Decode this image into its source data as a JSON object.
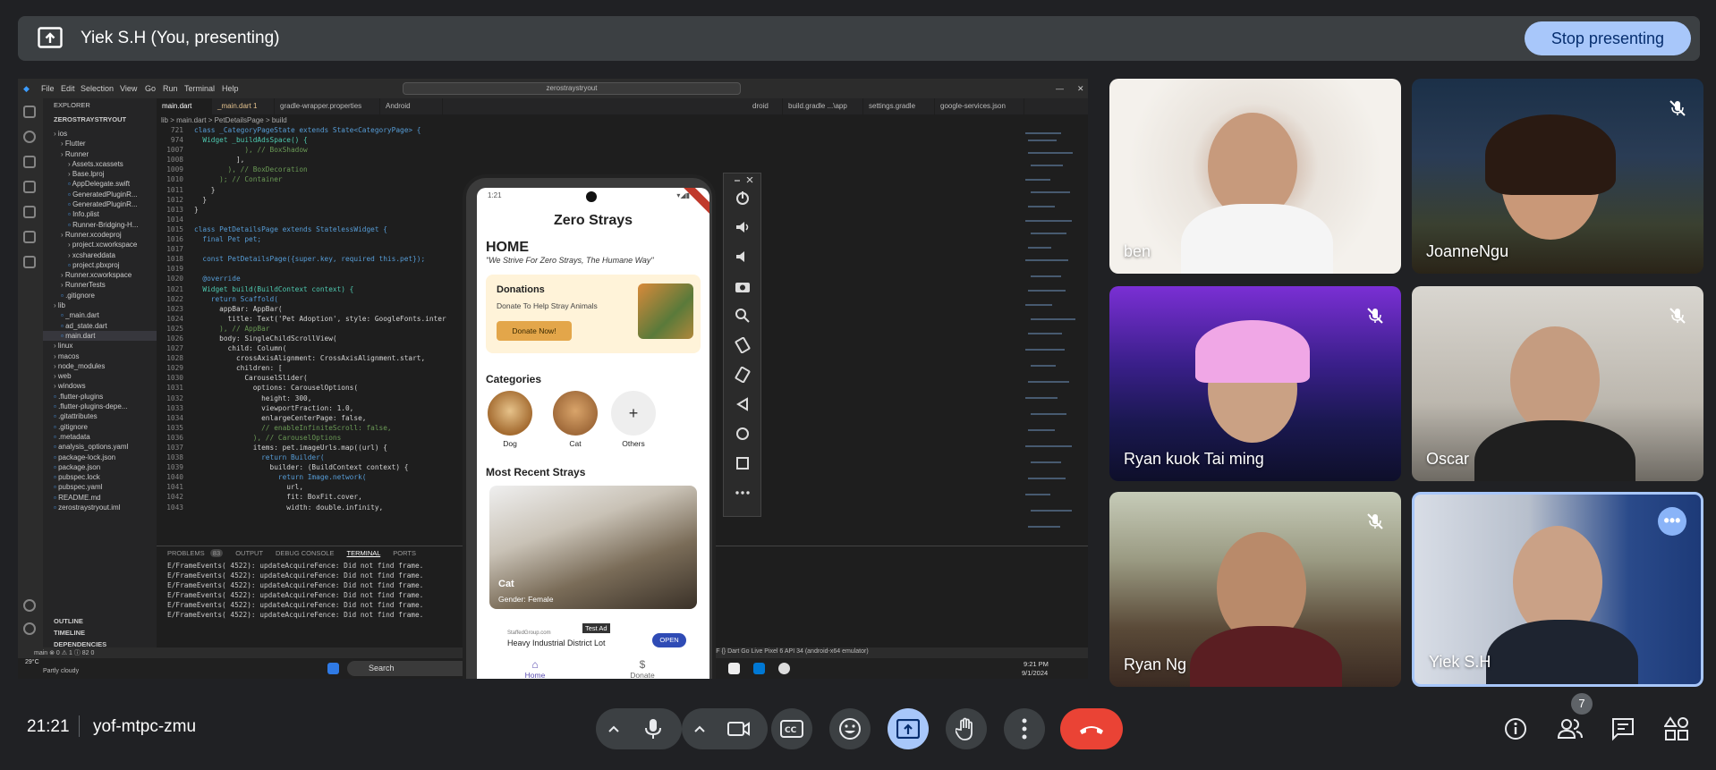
{
  "banner": {
    "title": "Yiek S.H (You, presenting)",
    "stop_label": "Stop presenting"
  },
  "vscode": {
    "menu": [
      "File",
      "Edit",
      "Selection",
      "View",
      "Go",
      "Run",
      "Terminal",
      "Help"
    ],
    "search": "zerostraystryout",
    "explorer_title": "EXPLORER",
    "project": "ZEROSTRAYSTRYOUT",
    "tree": [
      {
        "label": "ios",
        "indent": 0,
        "type": "folder"
      },
      {
        "label": "Flutter",
        "indent": 1,
        "type": "folder"
      },
      {
        "label": "Runner",
        "indent": 1,
        "type": "folder"
      },
      {
        "label": "Assets.xcassets",
        "indent": 2,
        "type": "folder"
      },
      {
        "label": "Base.lproj",
        "indent": 2,
        "type": "folder"
      },
      {
        "label": "AppDelegate.swift",
        "indent": 2,
        "type": "file"
      },
      {
        "label": "GeneratedPluginR...",
        "indent": 2,
        "type": "file"
      },
      {
        "label": "GeneratedPluginR...",
        "indent": 2,
        "type": "file"
      },
      {
        "label": "Info.plist",
        "indent": 2,
        "type": "file"
      },
      {
        "label": "Runner-Bridging-H...",
        "indent": 2,
        "type": "file"
      },
      {
        "label": "Runner.xcodeproj",
        "indent": 1,
        "type": "folder"
      },
      {
        "label": "project.xcworkspace",
        "indent": 2,
        "type": "folder"
      },
      {
        "label": "xcshareddata",
        "indent": 2,
        "type": "folder"
      },
      {
        "label": "project.pbxproj",
        "indent": 2,
        "type": "file"
      },
      {
        "label": "Runner.xcworkspace",
        "indent": 1,
        "type": "folder"
      },
      {
        "label": "RunnerTests",
        "indent": 1,
        "type": "folder"
      },
      {
        "label": ".gitignore",
        "indent": 1,
        "type": "file"
      },
      {
        "label": "lib",
        "indent": 0,
        "type": "folder"
      },
      {
        "label": "_main.dart",
        "indent": 1,
        "type": "file"
      },
      {
        "label": "ad_state.dart",
        "indent": 1,
        "type": "file"
      },
      {
        "label": "main.dart",
        "indent": 1,
        "type": "file",
        "selected": true
      },
      {
        "label": "linux",
        "indent": 0,
        "type": "folder"
      },
      {
        "label": "macos",
        "indent": 0,
        "type": "folder"
      },
      {
        "label": "node_modules",
        "indent": 0,
        "type": "folder"
      },
      {
        "label": "web",
        "indent": 0,
        "type": "folder"
      },
      {
        "label": "windows",
        "indent": 0,
        "type": "folder"
      },
      {
        "label": ".flutter-plugins",
        "indent": 0,
        "type": "file"
      },
      {
        "label": ".flutter-plugins-depe...",
        "indent": 0,
        "type": "file"
      },
      {
        "label": ".gitattributes",
        "indent": 0,
        "type": "file"
      },
      {
        "label": ".gitignore",
        "indent": 0,
        "type": "file"
      },
      {
        "label": ".metadata",
        "indent": 0,
        "type": "file"
      },
      {
        "label": "analysis_options.yaml",
        "indent": 0,
        "type": "file"
      },
      {
        "label": "package-lock.json",
        "indent": 0,
        "type": "file"
      },
      {
        "label": "package.json",
        "indent": 0,
        "type": "file"
      },
      {
        "label": "pubspec.lock",
        "indent": 0,
        "type": "file"
      },
      {
        "label": "pubspec.yaml",
        "indent": 0,
        "type": "file"
      },
      {
        "label": "README.md",
        "indent": 0,
        "type": "file"
      },
      {
        "label": "zerostraystryout.iml",
        "indent": 0,
        "type": "file"
      }
    ],
    "outline": [
      "OUTLINE",
      "TIMELINE",
      "DEPENDENCIES"
    ],
    "tabs": [
      "main.dart",
      "_main.dart 1",
      "gradle-wrapper.properties",
      "Android",
      "droid",
      "build.gradle ...\\app",
      "settings.gradle",
      "google-services.json"
    ],
    "breadcrumb": "lib > main.dart > PetDetailsPage > build",
    "code": [
      {
        "n": "721",
        "t": "class _CategoryPageState extends State<CategoryPage> {"
      },
      {
        "n": "974",
        "t": "  Widget _buildAdsSpace() {"
      },
      {
        "n": "1007",
        "t": "            ), // BoxShadow"
      },
      {
        "n": "1008",
        "t": "          ],"
      },
      {
        "n": "1009",
        "t": "        ), // BoxDecoration"
      },
      {
        "n": "1010",
        "t": "      ); // Container"
      },
      {
        "n": "1011",
        "t": "    }"
      },
      {
        "n": "1012",
        "t": "  }"
      },
      {
        "n": "1013",
        "t": "}"
      },
      {
        "n": "1014",
        "t": ""
      },
      {
        "n": "1015",
        "t": "class PetDetailsPage extends StatelessWidget {"
      },
      {
        "n": "1016",
        "t": "  final Pet pet;"
      },
      {
        "n": "1017",
        "t": ""
      },
      {
        "n": "1018",
        "t": "  const PetDetailsPage({super.key, required this.pet});"
      },
      {
        "n": "1019",
        "t": ""
      },
      {
        "n": "1020",
        "t": "  @override"
      },
      {
        "n": "1021",
        "t": "  Widget build(BuildContext context) {"
      },
      {
        "n": "1022",
        "t": "    return Scaffold("
      },
      {
        "n": "1023",
        "t": "      appBar: AppBar("
      },
      {
        "n": "1024",
        "t": "        title: Text('Pet Adoption', style: GoogleFonts.inter"
      },
      {
        "n": "1025",
        "t": "      ), // AppBar"
      },
      {
        "n": "1026",
        "t": "      body: SingleChildScrollView("
      },
      {
        "n": "1027",
        "t": "        child: Column("
      },
      {
        "n": "1028",
        "t": "          crossAxisAlignment: CrossAxisAlignment.start,"
      },
      {
        "n": "1029",
        "t": "          children: ["
      },
      {
        "n": "1030",
        "t": "            CarouselSlider("
      },
      {
        "n": "1031",
        "t": "              options: CarouselOptions("
      },
      {
        "n": "1032",
        "t": "                height: 300,"
      },
      {
        "n": "1033",
        "t": "                viewportFraction: 1.0,"
      },
      {
        "n": "1034",
        "t": "                enlargeCenterPage: false,"
      },
      {
        "n": "1035",
        "t": "                // enableInfiniteScroll: false,"
      },
      {
        "n": "1036",
        "t": "              ), // CarouselOptions"
      },
      {
        "n": "1037",
        "t": "              items: pet.imageUrls.map((url) {"
      },
      {
        "n": "1038",
        "t": "                return Builder("
      },
      {
        "n": "1039",
        "t": "                  builder: (BuildContext context) {"
      },
      {
        "n": "1040",
        "t": "                    return Image.network("
      },
      {
        "n": "1041",
        "t": "                      url,"
      },
      {
        "n": "1042",
        "t": "                      fit: BoxFit.cover,"
      },
      {
        "n": "1043",
        "t": "                      width: double.infinity,"
      }
    ],
    "panel_tabs": [
      "PROBLEMS",
      "83",
      "OUTPUT",
      "DEBUG CONSOLE",
      "TERMINAL",
      "PORTS"
    ],
    "terminal_lines": [
      "E/FrameEvents( 4522): updateAcquireFence: Did not find frame.",
      "E/FrameEvents( 4522): updateAcquireFence: Did not find frame.",
      "E/FrameEvents( 4522): updateAcquireFence: Did not find frame.",
      "E/FrameEvents( 4522): updateAcquireFence: Did not find frame.",
      "E/FrameEvents( 4522): updateAcquireFence: Did not find frame.",
      "E/FrameEvents( 4522): updateAcquireFence: Did not find frame."
    ],
    "status_left": "main  ⊗ 0 ⚠ 1 ⓘ 82   0",
    "status_right": "Ln 1066, Col 21   Spaces: 2   UTF-8   CRLF   {} Dart   Go Live   Pixel 6 API 34 (android-x64 emulator)"
  },
  "taskbar": {
    "weather_temp": "29°C",
    "weather_desc": "Partly cloudy",
    "search": "Search",
    "time": "9:21 PM",
    "date": "9/1/2024"
  },
  "phone": {
    "time": "1:21",
    "app_title": "Zero Strays",
    "home": "HOME",
    "tagline": "\"We Strive For Zero Strays, The Humane Way\"",
    "donations_title": "Donations",
    "donations_sub": "Donate To Help Stray Animals",
    "donate_btn": "Donate Now!",
    "categories_title": "Categories",
    "categories": [
      "Dog",
      "Cat",
      "Others"
    ],
    "recent_title": "Most Recent Strays",
    "stray_name": "Cat",
    "stray_gender": "Gender: Female",
    "ad_label": "Test Ad",
    "ad_source": "StaffedGroup.com",
    "ad_text": "Heavy Industrial District Lot",
    "ad_btn": "OPEN",
    "nav": [
      "Home",
      "Donate"
    ]
  },
  "participants": [
    {
      "name": "ben",
      "muted": false
    },
    {
      "name": "JoanneNgu",
      "muted": true
    },
    {
      "name": "Ryan kuok Tai ming",
      "muted": true
    },
    {
      "name": "Oscar",
      "muted": true
    },
    {
      "name": "Ryan Ng",
      "muted": true
    },
    {
      "name": "Yiek S.H",
      "muted": false,
      "active": true
    }
  ],
  "meeting": {
    "time": "21:21",
    "code": "yof-mtpc-zmu",
    "participants_count": "7"
  },
  "colors": {
    "bg": "#202124",
    "accent": "#a8c7fa",
    "end": "#ea4335"
  }
}
